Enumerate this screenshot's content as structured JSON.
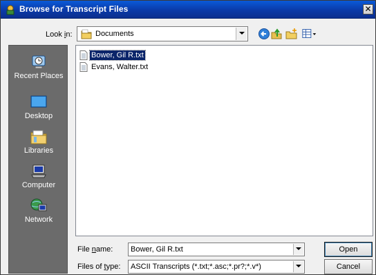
{
  "window": {
    "title": "Browse for Transcript Files",
    "close_label": "✕"
  },
  "lookin": {
    "label": "Look in:",
    "value": "Documents"
  },
  "toolbar": {
    "icons": [
      "back-icon",
      "up-folder-icon",
      "new-folder-icon",
      "view-menu-icon"
    ]
  },
  "places": [
    {
      "label": "Recent Places",
      "icon": "recent-places-icon"
    },
    {
      "label": "Desktop",
      "icon": "desktop-icon"
    },
    {
      "label": "Libraries",
      "icon": "libraries-icon"
    },
    {
      "label": "Computer",
      "icon": "computer-icon"
    },
    {
      "label": "Network",
      "icon": "network-icon"
    }
  ],
  "files": [
    {
      "name": "Bower, Gil R.txt",
      "selected": true
    },
    {
      "name": "Evans, Walter.txt",
      "selected": false
    }
  ],
  "filename": {
    "label": "File name:",
    "value": "Bower, Gil R.txt"
  },
  "filetype": {
    "label": "Files of type:",
    "value": "ASCII Transcripts (*.txt;*.asc;*.pr?;*.v*)"
  },
  "buttons": {
    "open": "Open",
    "cancel": "Cancel"
  },
  "colors": {
    "titlebar": "#0a3aa8",
    "places_bg": "#6b6b6b",
    "selection": "#0a246a"
  }
}
